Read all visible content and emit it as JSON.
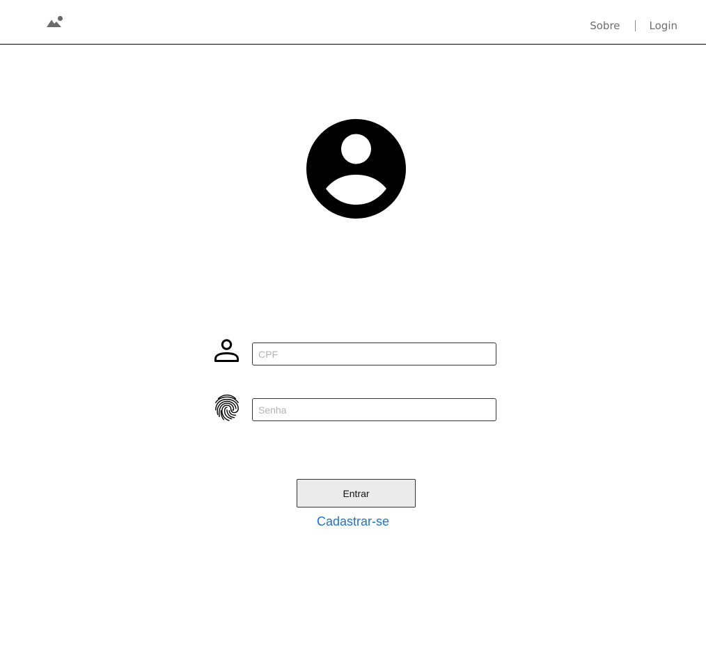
{
  "header": {
    "logo_icon": "mountain-image-icon",
    "nav": {
      "about_label": "Sobre",
      "login_label": "Login"
    }
  },
  "main": {
    "avatar_icon": "account-circle-icon",
    "cpf_field": {
      "icon": "person-icon",
      "placeholder": "CPF",
      "value": ""
    },
    "password_field": {
      "icon": "fingerprint-icon",
      "placeholder": "Senha",
      "value": ""
    },
    "submit_label": "Entrar",
    "register_label": "Cadastrar-se"
  },
  "colors": {
    "link": "#1a73d9",
    "button_bg": "#ebebeb",
    "nav_text": "#6e6e6e"
  }
}
